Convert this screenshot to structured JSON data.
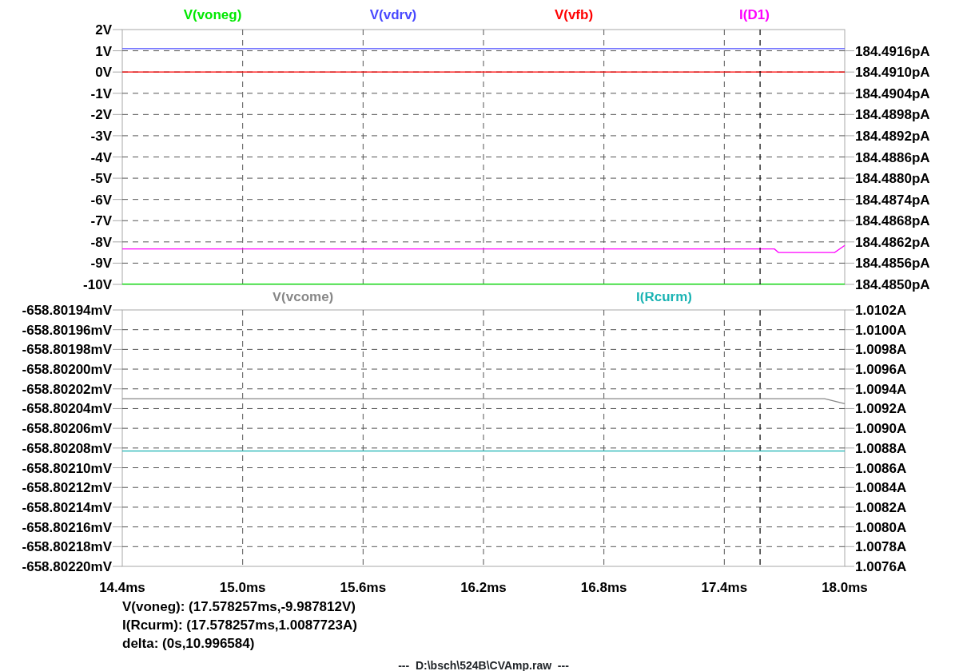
{
  "panes": [
    {
      "chart_data": {
        "type": "line",
        "x": [
          14.4,
          16.08,
          16.1,
          17.65,
          17.67,
          17.95,
          18.0
        ],
        "xlim": [
          14.4,
          18.0
        ],
        "ylim": [
          -10,
          2
        ],
        "yticks": [
          {
            "value": 2,
            "label": "2V"
          },
          {
            "value": 1,
            "label": "1V"
          },
          {
            "value": 0,
            "label": "0V"
          },
          {
            "value": -1,
            "label": "-1V"
          },
          {
            "value": -2,
            "label": "-2V"
          },
          {
            "value": -3,
            "label": "-3V"
          },
          {
            "value": -4,
            "label": "-4V"
          },
          {
            "value": -5,
            "label": "-5V"
          },
          {
            "value": -6,
            "label": "-6V"
          },
          {
            "value": -7,
            "label": "-7V"
          },
          {
            "value": -8,
            "label": "-8V"
          },
          {
            "value": -9,
            "label": "-9V"
          },
          {
            "value": -10,
            "label": "-10V"
          }
        ],
        "y2lim": [
          184.485,
          184.4922
        ],
        "y2ticks": [
          {
            "value": 184.4916,
            "label": "184.4916pA"
          },
          {
            "value": 184.491,
            "label": "184.4910pA"
          },
          {
            "value": 184.4904,
            "label": "184.4904pA"
          },
          {
            "value": 184.4898,
            "label": "184.4898pA"
          },
          {
            "value": 184.4892,
            "label": "184.4892pA"
          },
          {
            "value": 184.4886,
            "label": "184.4886pA"
          },
          {
            "value": 184.488,
            "label": "184.4880pA"
          },
          {
            "value": 184.4874,
            "label": "184.4874pA"
          },
          {
            "value": 184.4868,
            "label": "184.4868pA"
          },
          {
            "value": 184.4862,
            "label": "184.4862pA"
          },
          {
            "value": 184.4856,
            "label": "184.4856pA"
          },
          {
            "value": 184.485,
            "label": "184.4850pA"
          }
        ],
        "series": [
          {
            "name": "V(voneg)",
            "color": "#00e800",
            "values": [
              -9.99,
              -9.99,
              -9.99,
              -9.99,
              -9.99,
              -9.99,
              -9.99
            ]
          },
          {
            "name": "V(vdrv)",
            "color": "#4848ff",
            "values": [
              1.1,
              1.1,
              1.1,
              1.1,
              1.1,
              1.1,
              1.1
            ]
          },
          {
            "name": "V(vfb)",
            "color": "#ff0000",
            "values": [
              0,
              0,
              0,
              0,
              0,
              0,
              0
            ]
          },
          {
            "name": "I(D1)",
            "color": "#ff00ff",
            "axis": "y2",
            "values": [
              184.486,
              184.486,
              184.486,
              184.486,
              184.4859,
              184.4859,
              184.4861
            ]
          }
        ],
        "grid": true,
        "ref_lines": [
          {
            "axis": "x",
            "value": 17.578257
          }
        ]
      }
    },
    {
      "chart_data": {
        "type": "line",
        "x": [
          14.4,
          17.9,
          18.0
        ],
        "xlim": [
          14.4,
          18.0
        ],
        "xticks": [
          {
            "value": 14.4,
            "label": "14.4ms"
          },
          {
            "value": 15.0,
            "label": "15.0ms"
          },
          {
            "value": 15.6,
            "label": "15.6ms"
          },
          {
            "value": 16.2,
            "label": "16.2ms"
          },
          {
            "value": 16.8,
            "label": "16.8ms"
          },
          {
            "value": 17.4,
            "label": "17.4ms"
          },
          {
            "value": 18.0,
            "label": "18.0ms"
          }
        ],
        "ylim": [
          -658.8022,
          -658.80194
        ],
        "yticks": [
          {
            "value": -658.80194,
            "label": "-658.80194mV"
          },
          {
            "value": -658.80196,
            "label": "-658.80196mV"
          },
          {
            "value": -658.80198,
            "label": "-658.80198mV"
          },
          {
            "value": -658.802,
            "label": "-658.80200mV"
          },
          {
            "value": -658.80202,
            "label": "-658.80202mV"
          },
          {
            "value": -658.80204,
            "label": "-658.80204mV"
          },
          {
            "value": -658.80206,
            "label": "-658.80206mV"
          },
          {
            "value": -658.80208,
            "label": "-658.80208mV"
          },
          {
            "value": -658.8021,
            "label": "-658.80210mV"
          },
          {
            "value": -658.80212,
            "label": "-658.80212mV"
          },
          {
            "value": -658.80214,
            "label": "-658.80214mV"
          },
          {
            "value": -658.80216,
            "label": "-658.80216mV"
          },
          {
            "value": -658.80218,
            "label": "-658.80218mV"
          },
          {
            "value": -658.8022,
            "label": "-658.80220mV"
          }
        ],
        "y2lim": [
          1.0076,
          1.0102
        ],
        "y2ticks": [
          {
            "value": 1.0102,
            "label": "1.0102A"
          },
          {
            "value": 1.01,
            "label": "1.0100A"
          },
          {
            "value": 1.0098,
            "label": "1.0098A"
          },
          {
            "value": 1.0096,
            "label": "1.0096A"
          },
          {
            "value": 1.0094,
            "label": "1.0094A"
          },
          {
            "value": 1.0092,
            "label": "1.0092A"
          },
          {
            "value": 1.009,
            "label": "1.0090A"
          },
          {
            "value": 1.0088,
            "label": "1.0088A"
          },
          {
            "value": 1.0086,
            "label": "1.0086A"
          },
          {
            "value": 1.0084,
            "label": "1.0084A"
          },
          {
            "value": 1.0082,
            "label": "1.0082A"
          },
          {
            "value": 1.008,
            "label": "1.0080A"
          },
          {
            "value": 1.0078,
            "label": "1.0078A"
          },
          {
            "value": 1.0076,
            "label": "1.0076A"
          }
        ],
        "series": [
          {
            "name": "V(vcome)",
            "color": "#888888",
            "values": [
              -658.80203,
              -658.80203,
              -658.802035
            ]
          },
          {
            "name": "I(Rcurm)",
            "color": "#1cb4b4",
            "axis": "y2",
            "values": [
              1.00877,
              1.00877,
              1.00877
            ]
          }
        ],
        "grid": true,
        "ref_lines": [
          {
            "axis": "x",
            "value": 17.578257
          }
        ]
      }
    }
  ],
  "cursor_readout": [
    "V(voneg): (17.578257ms,-9.987812V)",
    "I(Rcurm): (17.578257ms,1.0087723A)",
    "delta: (0s,10.996584)"
  ],
  "file_label": "---  D:\\bsch\\524B\\CVAmp.raw  ---"
}
